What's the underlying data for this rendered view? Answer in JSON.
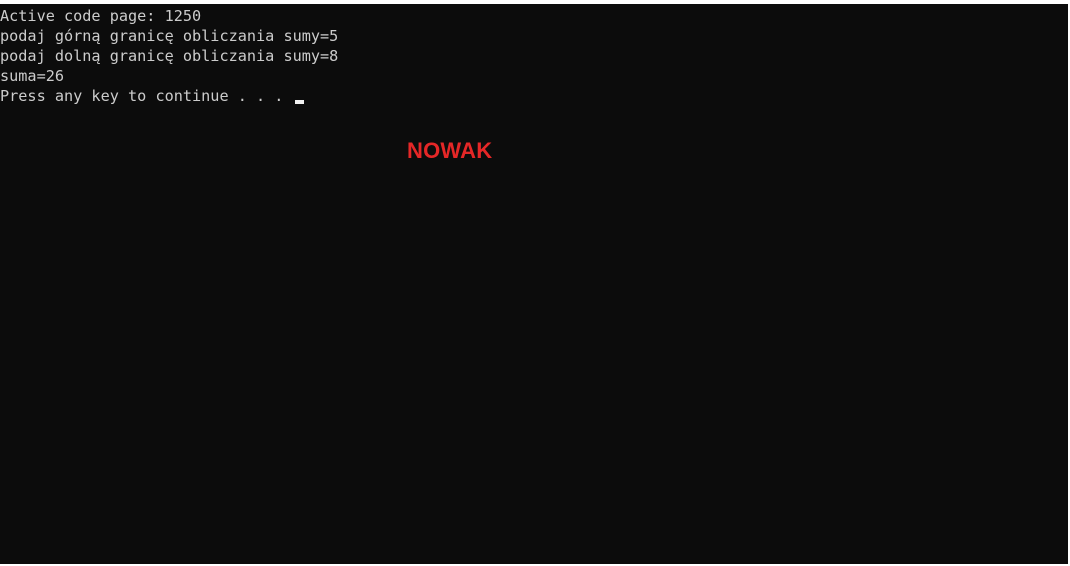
{
  "console": {
    "lines": [
      "Active code page: 1250",
      "podaj górną granicę obliczania sumy=5",
      "podaj dolną granicę obliczania sumy=8",
      "suma=26",
      "Press any key to continue . . . "
    ],
    "cursor": "block-cursor"
  },
  "overlay": {
    "text": "NOWAK",
    "color": "#e52727"
  },
  "colors": {
    "background": "#0c0c0c",
    "text": "#cccccc"
  }
}
